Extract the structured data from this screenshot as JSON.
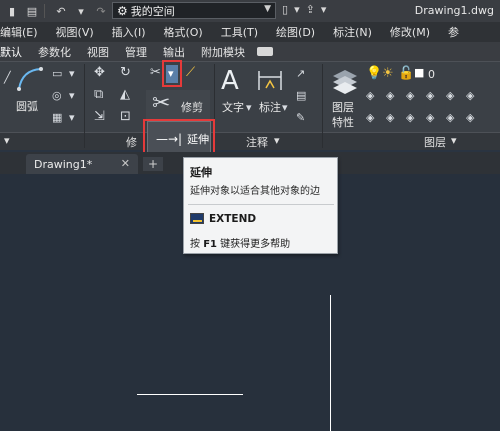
{
  "titlebar": {
    "workspace": "我的空间",
    "document_title": "Drawing1.dwg"
  },
  "menus": [
    "编辑(E)",
    "视图(V)",
    "插入(I)",
    "格式(O)",
    "工具(T)",
    "绘图(D)",
    "标注(N)",
    "修改(M)",
    "参"
  ],
  "ribbon_tabs": [
    "默认",
    "参数化",
    "视图",
    "管理",
    "输出",
    "附加模块"
  ],
  "ribbon": {
    "arc_label": "圆弧",
    "trim_label": "修剪",
    "text_label": "文字",
    "dimension_label": "标注",
    "layer_props_label_1": "图层",
    "layer_props_label_2": "特性",
    "layer_value": "0",
    "extend_label": "延伸",
    "panels": {
      "modify": "修",
      "annotation": "注释",
      "layers": "图层"
    }
  },
  "file_tab": {
    "name": "Drawing1*"
  },
  "tooltip": {
    "title": "延伸",
    "description": "延伸对象以适合其他对象的边",
    "command": "EXTEND",
    "help_prefix": "按",
    "help_key": "F1",
    "help_suffix": "键获得更多帮助"
  },
  "colors": {
    "highlight_red": "#e53a3a",
    "canvas": "#27303c"
  }
}
